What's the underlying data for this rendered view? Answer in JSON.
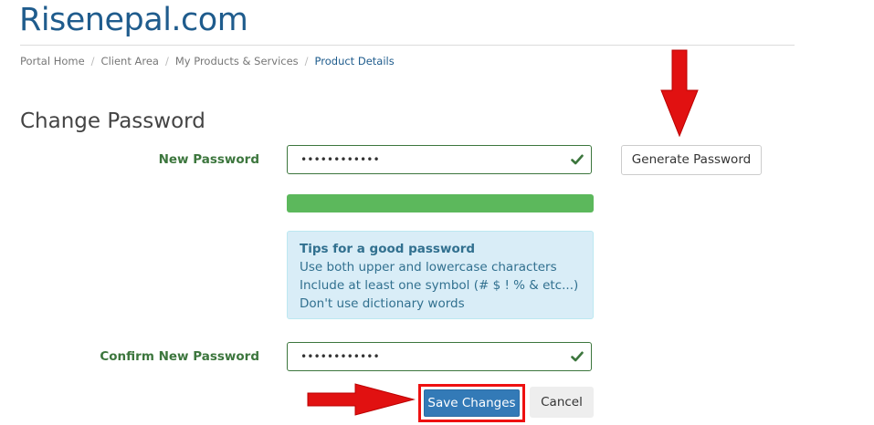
{
  "site": {
    "brand": "Risenepal.com"
  },
  "breadcrumb": {
    "items": [
      "Portal Home",
      "Client Area",
      "My Products & Services",
      "Product Details"
    ]
  },
  "page": {
    "title": "Change Password"
  },
  "form": {
    "new_password_label": "New Password",
    "new_password_value": "••••••••••••",
    "confirm_password_label": "Confirm New Password",
    "confirm_password_value": "••••••••••••",
    "generate_button": "Generate Password",
    "strength_fraction": 1.0,
    "save_button": "Save Changes",
    "cancel_button": "Cancel"
  },
  "tips": {
    "title": "Tips for a good password",
    "lines": [
      "Use both upper and lowercase characters",
      "Include at least one symbol (# $ ! % & etc...)",
      "Don't use dictionary words"
    ]
  },
  "icons": {
    "valid": "checkmark-icon",
    "annotation": "red-arrow"
  },
  "colors": {
    "brand": "#1f5c8d",
    "success": "#3c763d",
    "strength_bar": "#5cb85c",
    "primary_button": "#337ab7",
    "annotation": "#e11111"
  }
}
